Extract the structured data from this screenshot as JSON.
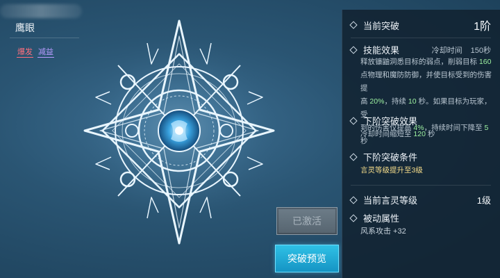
{
  "skill": {
    "name": "鹰眼",
    "tags": [
      "爆发",
      "减益"
    ]
  },
  "buttons": {
    "activated": "已激活",
    "preview": "突破预览"
  },
  "panel": {
    "current_breakthrough": {
      "label": "当前突破",
      "value": "1阶"
    },
    "skill_effect": {
      "label": "技能效果",
      "cooldown_label": "冷却时间",
      "cooldown_value": "150秒",
      "desc": {
        "l1": "释放镰鼬洞悉目标的弱点，削弱目标 ",
        "v1": "160",
        "l2": "点物理和魔防防御，并使目标受到的伤害提",
        "l3a": "高 ",
        "v2": "20%",
        "l3b": "，持续 ",
        "v3": "10",
        "l3c": " 秒。如果目标为玩家，受",
        "l4a": "到的伤害仅提高 ",
        "v4": "4%",
        "l4b": "，持续时间下降至 ",
        "v5": "5",
        "l4c": " 秒"
      }
    },
    "next_effect": {
      "label": "下阶突破效果",
      "desc_a": "冷却时间缩短至 ",
      "desc_v": "120",
      "desc_b": " 秒"
    },
    "next_condition": {
      "label": "下阶突破条件",
      "desc": "言灵等级提升至3级"
    },
    "current_level": {
      "label": "当前言灵等级",
      "value": "1级"
    },
    "passive": {
      "label": "被动属性",
      "desc": "风系攻击 +32"
    }
  },
  "colors": {
    "highlight_green": "#9df0a0",
    "condition_gold": "#f5dc8a",
    "tag_burst": "#ff6f7d",
    "tag_debuff": "#b89cff",
    "preview_button": "#1ea8d6"
  }
}
